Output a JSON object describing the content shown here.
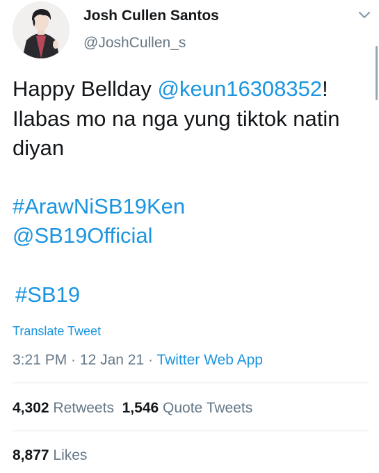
{
  "author": {
    "display_name": "Josh Cullen Santos",
    "handle": "@JoshCullen_s"
  },
  "icons": {
    "avatar": "profile-avatar",
    "menu": "chevron-down-icon"
  },
  "tweet": {
    "line1_text": "Happy Bellday ",
    "line1_mention": "@keun16308352",
    "line1_end": "!",
    "line2": "Ilabas mo na nga yung tiktok natin",
    "line3": "diyan",
    "hashtag1": "#ArawNiSB19Ken",
    "mention2": "@SB19Official",
    "hashtag2": "#SB19"
  },
  "translate_label": "Translate Tweet",
  "meta": {
    "time": "3:21 PM",
    "sep1": " · ",
    "date": "12 Jan 21",
    "sep2": " · ",
    "source": "Twitter Web App"
  },
  "stats": {
    "retweets_count": "4,302",
    "retweets_label": "Retweets",
    "quotes_count": "1,546",
    "quotes_label": "Quote Tweets",
    "likes_count": "8,877",
    "likes_label": "Likes"
  },
  "colors": {
    "link": "#1b95e0",
    "secondary_text": "#657786",
    "primary_text": "#14171a",
    "divider": "#e1e8ed"
  }
}
